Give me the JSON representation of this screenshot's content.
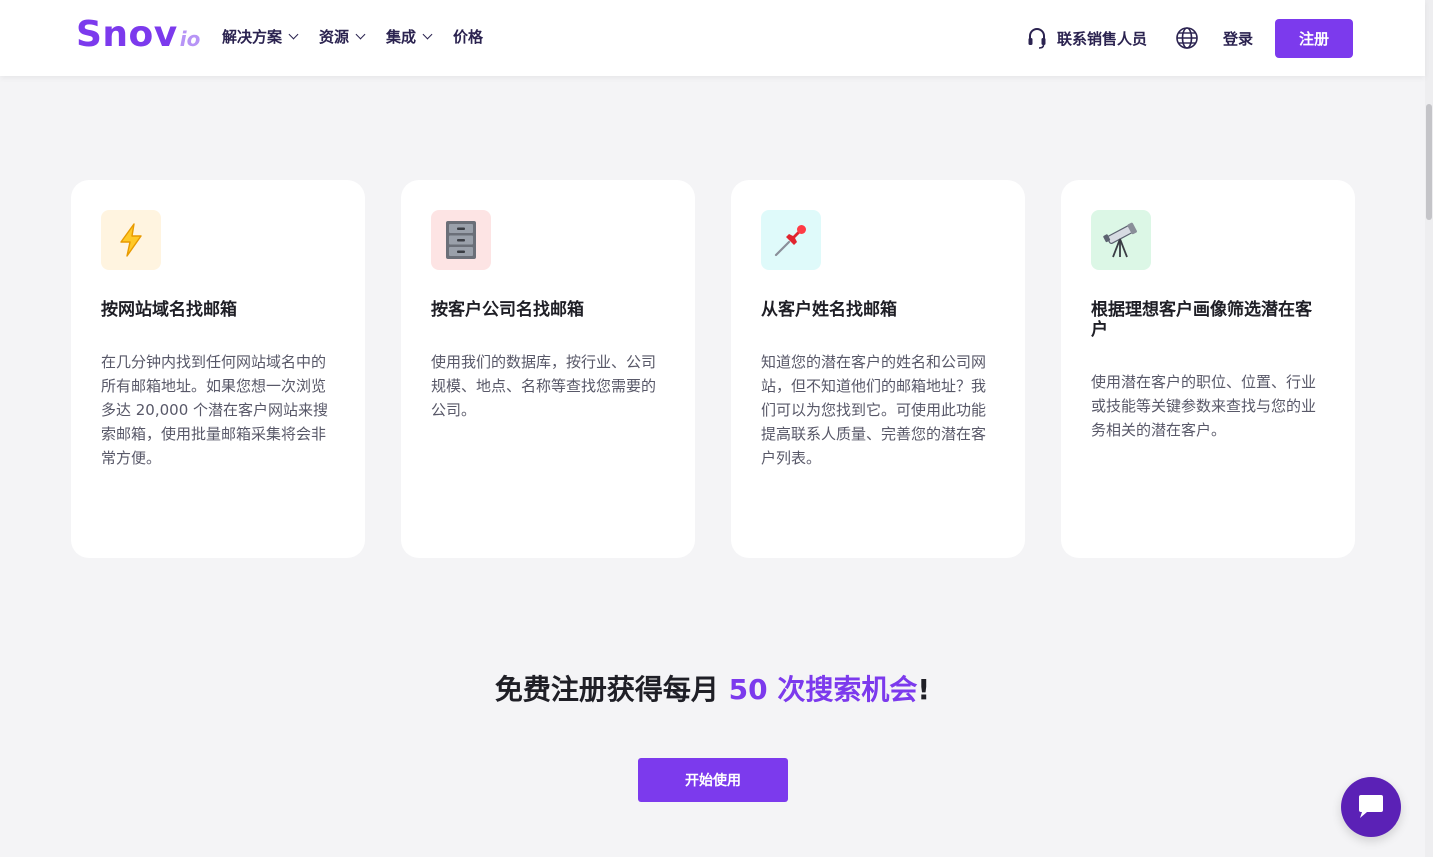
{
  "brand": {
    "logo_main": "Snov",
    "logo_sub": "io",
    "accent_color": "#7c3aed"
  },
  "header": {
    "nav": [
      {
        "label": "解决方案",
        "has_dropdown": true
      },
      {
        "label": "资源",
        "has_dropdown": true
      },
      {
        "label": "集成",
        "has_dropdown": true
      },
      {
        "label": "价格",
        "has_dropdown": false
      }
    ],
    "contact_label": "联系销售人员",
    "login_label": "登录",
    "signup_label": "注册"
  },
  "cards": [
    {
      "icon": "lightning-icon",
      "icon_bg": "#fff4e0",
      "title": "按网站域名找邮箱",
      "description": "在几分钟内找到任何网站域名中的所有邮箱地址。如果您想一次浏览多达 20,000 个潜在客户网站来搜索邮箱，使用批量邮箱采集将会非常方便。"
    },
    {
      "icon": "file-cabinet-icon",
      "icon_bg": "#fde4e4",
      "title": "按客户公司名找邮箱",
      "description": "使用我们的数据库，按行业、公司规模、地点、名称等查找您需要的公司。"
    },
    {
      "icon": "pushpin-icon",
      "icon_bg": "#dffafa",
      "title": "从客户姓名找邮箱",
      "description": "知道您的潜在客户的姓名和公司网站，但不知道他们的邮箱地址？我们可以为您找到它。可使用此功能提高联系人质量、完善您的潜在客户列表。"
    },
    {
      "icon": "telescope-icon",
      "icon_bg": "#dcf7e6",
      "title": "根据理想客户画像筛选潜在客户",
      "description": "使用潜在客户的职位、位置、行业或技能等关键参数来查找与您的业务相关的潜在客户。"
    }
  ],
  "cta": {
    "title_prefix": "免费注册获得每月 ",
    "title_highlight": "50 次搜索机会",
    "title_suffix": "!",
    "button_label": "开始使用"
  },
  "chat": {
    "icon": "chat-bubble-icon"
  }
}
